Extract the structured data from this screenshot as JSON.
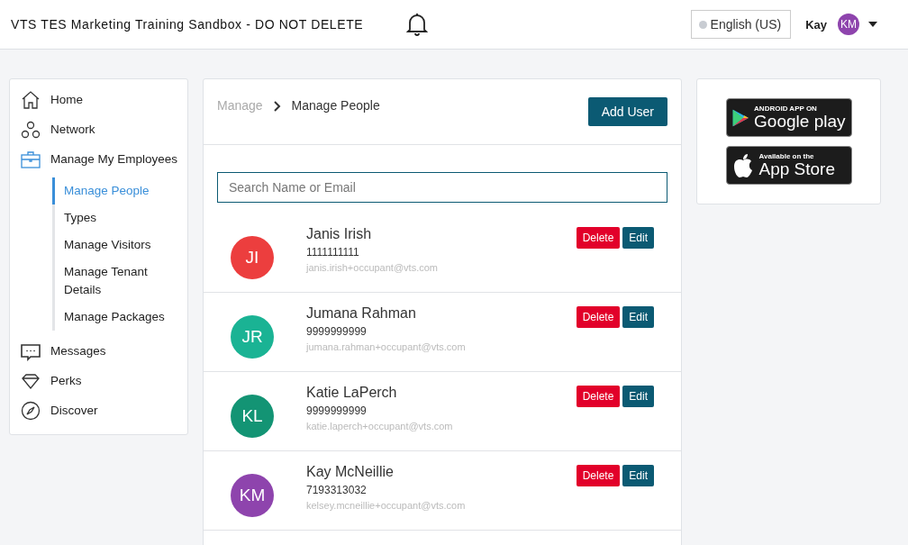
{
  "header": {
    "title": "VTS TES Marketing Training Sandbox - DO NOT DELETE",
    "language": "English (US)",
    "user": {
      "name": "Kay",
      "initials": "KM"
    }
  },
  "sidebar": {
    "items": [
      {
        "label": "Home",
        "kind": "home"
      },
      {
        "label": "Network",
        "kind": "network"
      },
      {
        "label": "Manage My Employees",
        "kind": "briefcase",
        "expanded": true,
        "children": [
          {
            "label": "Manage People",
            "selected": true
          },
          {
            "label": "Types",
            "selected": false
          },
          {
            "label": "Manage Visitors",
            "selected": false
          },
          {
            "label": "Manage Tenant Details",
            "selected": false
          },
          {
            "label": "Manage Packages",
            "selected": false
          }
        ]
      },
      {
        "label": "Messages",
        "kind": "chat"
      },
      {
        "label": "Perks",
        "kind": "diamond"
      },
      {
        "label": "Discover",
        "kind": "compass"
      }
    ]
  },
  "breadcrumb": [
    "Manage",
    "Manage People"
  ],
  "add_button": "Add User",
  "search": {
    "placeholder": "Search Name or Email"
  },
  "people": [
    {
      "initials": "JI",
      "color": "#ec3e3e",
      "name": "Janis Irish",
      "phone": "1111111111",
      "email": "janis.irish+occupant@vts.com",
      "delete": "Delete",
      "edit": "Edit"
    },
    {
      "initials": "JR",
      "color": "#1ab394",
      "name": "Jumana Rahman",
      "phone": "9999999999",
      "email": "jumana.rahman+occupant@vts.com",
      "delete": "Delete",
      "edit": "Edit"
    },
    {
      "initials": "KL",
      "color": "#139474",
      "name": "Katie LaPerch",
      "phone": "9999999999",
      "email": "katie.laperch+occupant@vts.com",
      "delete": "Delete",
      "edit": "Edit"
    },
    {
      "initials": "KM",
      "color": "#8e44ad",
      "name": "Kay McNeillie",
      "phone": "7193313032",
      "email": "kelsey.mcneillie+occupant@vts.com",
      "delete": "Delete",
      "edit": "Edit"
    }
  ],
  "stores": [
    {
      "kind": "google",
      "small": "ANDROID APP ON",
      "big": "Google play"
    },
    {
      "kind": "apple",
      "small": "Available on the",
      "big": "App Store"
    }
  ]
}
